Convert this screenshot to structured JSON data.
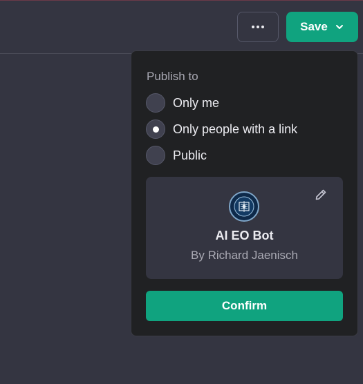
{
  "header": {
    "more_icon": "ellipsis-icon",
    "save_label": "Save",
    "save_icon": "chevron-down-icon"
  },
  "publish_menu": {
    "title": "Publish to",
    "options": [
      {
        "label": "Only me",
        "selected": false
      },
      {
        "label": "Only people with a link",
        "selected": true
      },
      {
        "label": "Public",
        "selected": false
      }
    ],
    "bot": {
      "name": "AI EO Bot",
      "author": "By Richard Jaenisch",
      "edit_icon": "pencil-icon"
    },
    "confirm_label": "Confirm"
  },
  "colors": {
    "accent": "#10a37f",
    "background": "#343541",
    "popover": "#202123"
  }
}
